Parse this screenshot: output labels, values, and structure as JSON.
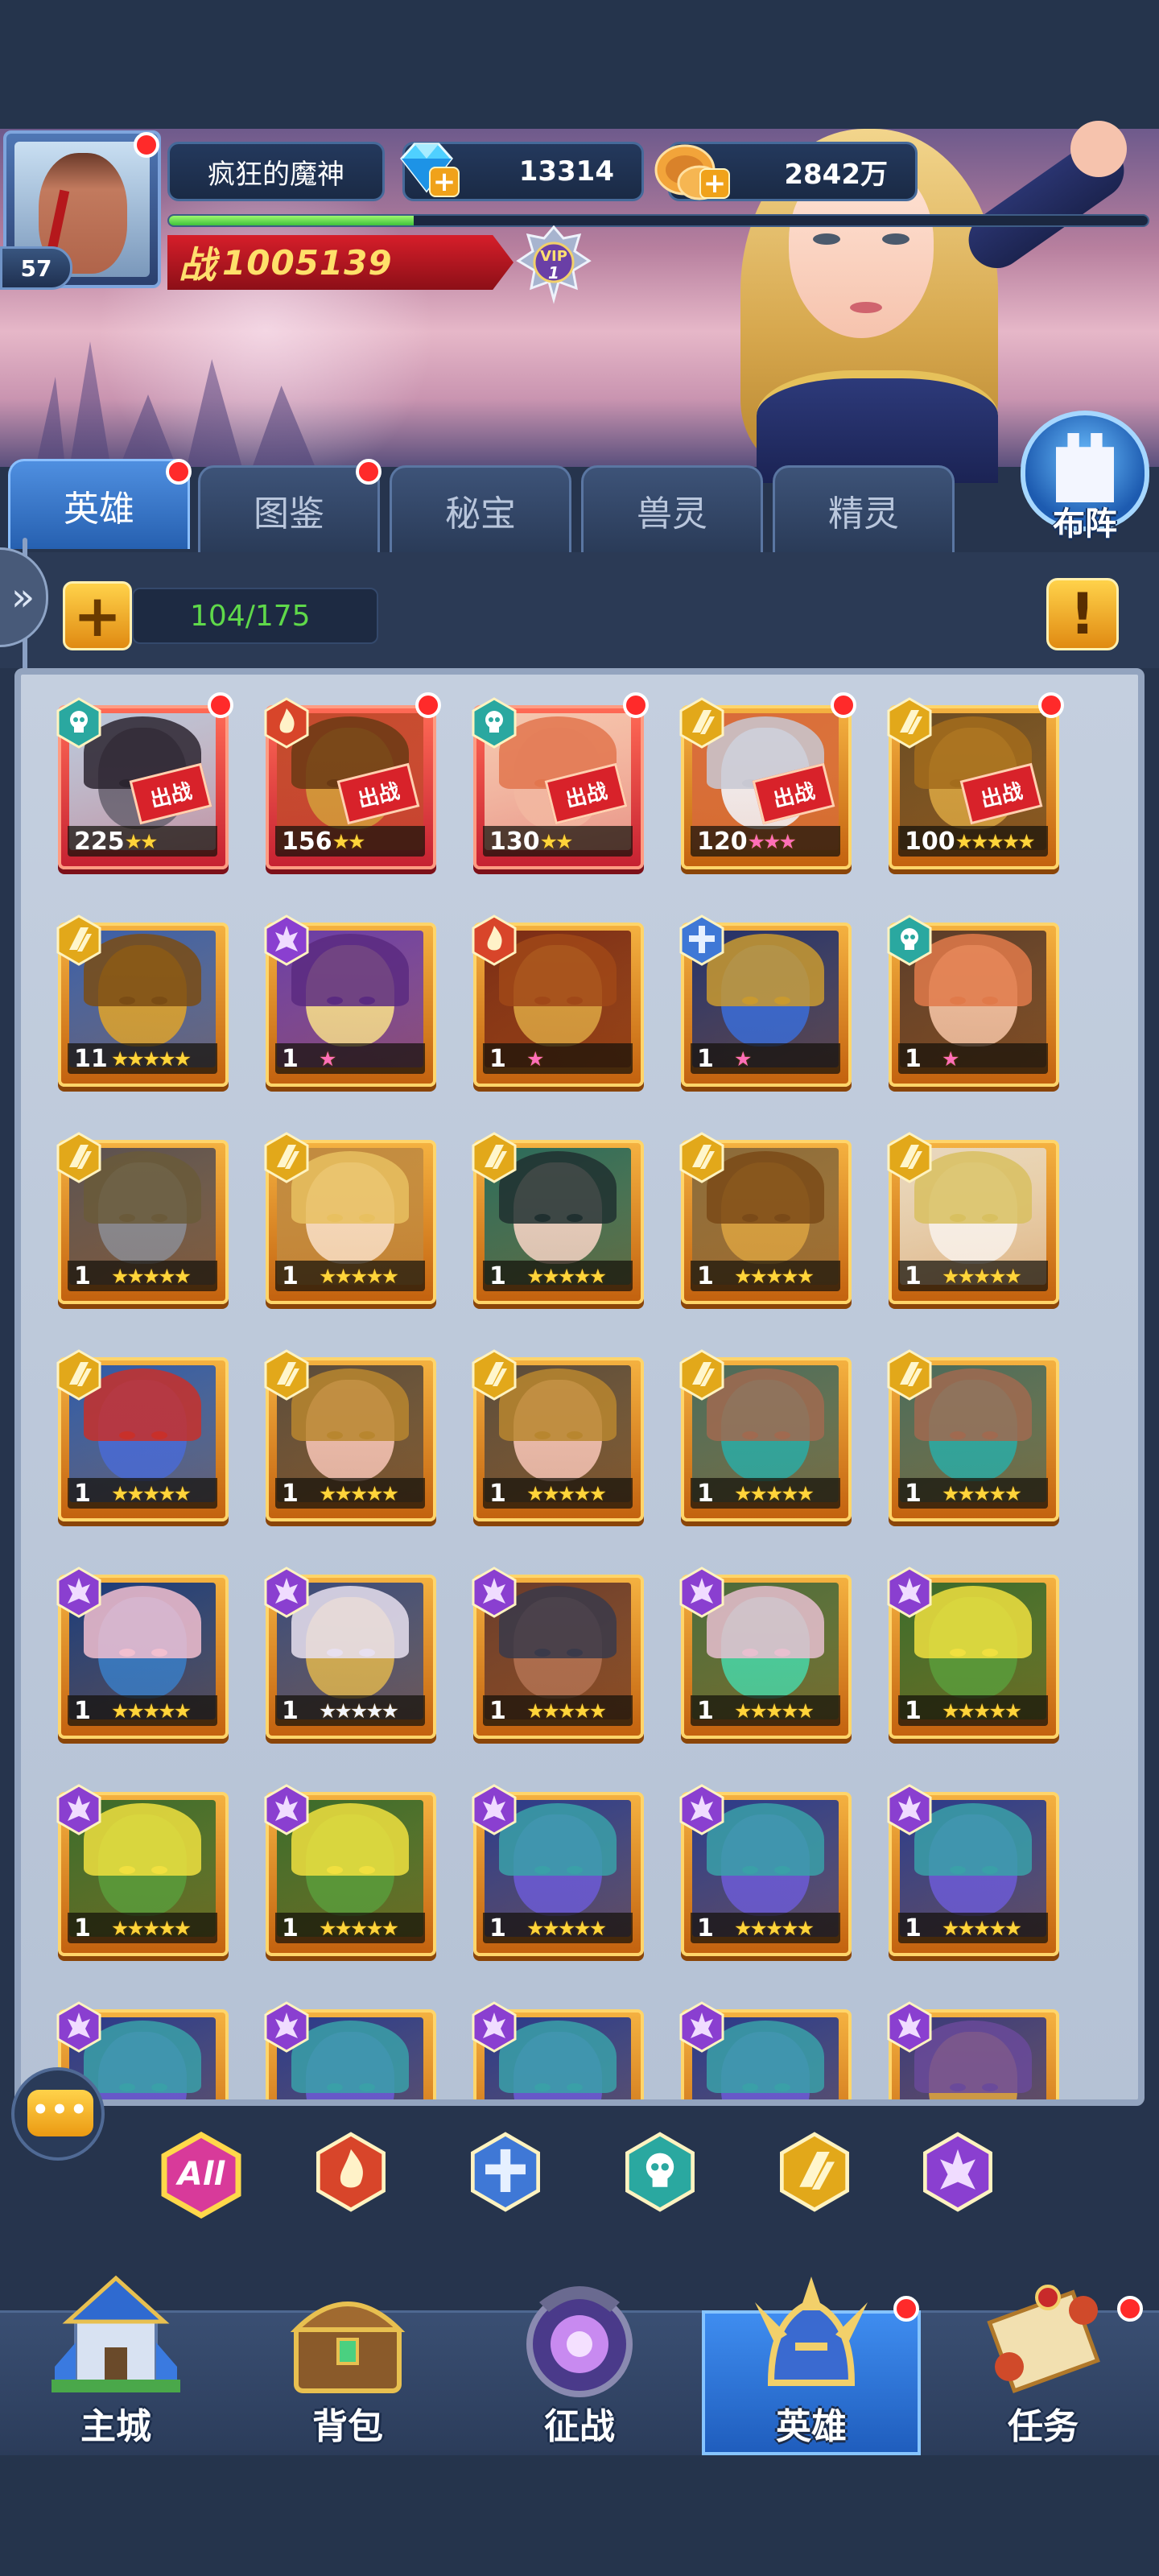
{
  "player": {
    "name": "疯狂的魔神",
    "level": "57",
    "gems": "13314",
    "gold": "2842万",
    "power_icon": "战",
    "power": "1005139",
    "vip_label": "VIP",
    "vip_level": "1",
    "xp_progress": 0.25
  },
  "tabs": [
    {
      "label": "英雄",
      "active": true,
      "dot": true
    },
    {
      "label": "图鉴",
      "active": false,
      "dot": true
    },
    {
      "label": "秘宝",
      "active": false,
      "dot": false
    },
    {
      "label": "兽灵",
      "active": false,
      "dot": false
    },
    {
      "label": "精灵",
      "active": false,
      "dot": false
    }
  ],
  "formation_label": "布阵",
  "hero_count": "104/175",
  "info_label": "!",
  "deploy_label": "出战",
  "heroes": [
    {
      "faction": "skull",
      "level": "225",
      "stars": 2,
      "star_color": "gold",
      "deployed": true,
      "dot": true,
      "red": true
    },
    {
      "faction": "fire",
      "level": "156",
      "stars": 2,
      "star_color": "gold",
      "deployed": true,
      "dot": true,
      "red": true
    },
    {
      "faction": "skull",
      "level": "130",
      "stars": 2,
      "star_color": "gold",
      "deployed": true,
      "dot": true,
      "red": true
    },
    {
      "faction": "light",
      "level": "120",
      "stars": 3,
      "star_color": "pink",
      "deployed": true,
      "dot": true,
      "red": false
    },
    {
      "faction": "light",
      "level": "100",
      "stars": 5,
      "star_color": "gold",
      "deployed": true,
      "dot": true,
      "red": false
    },
    {
      "faction": "light",
      "level": "11",
      "stars": 5,
      "star_color": "gold"
    },
    {
      "faction": "dark",
      "level": "1",
      "stars": 1,
      "star_color": "pink"
    },
    {
      "faction": "fire",
      "level": "1",
      "stars": 1,
      "star_color": "pink"
    },
    {
      "faction": "cross",
      "level": "1",
      "stars": 1,
      "star_color": "pink"
    },
    {
      "faction": "skull",
      "level": "1",
      "stars": 1,
      "star_color": "pink"
    },
    {
      "faction": "light",
      "level": "1",
      "stars": 5,
      "star_color": "gold"
    },
    {
      "faction": "light",
      "level": "1",
      "stars": 5,
      "star_color": "gold"
    },
    {
      "faction": "light",
      "level": "1",
      "stars": 5,
      "star_color": "gold"
    },
    {
      "faction": "light",
      "level": "1",
      "stars": 5,
      "star_color": "gold"
    },
    {
      "faction": "light",
      "level": "1",
      "stars": 5,
      "star_color": "gold"
    },
    {
      "faction": "light",
      "level": "1",
      "stars": 5,
      "star_color": "gold"
    },
    {
      "faction": "light",
      "level": "1",
      "stars": 5,
      "star_color": "gold"
    },
    {
      "faction": "light",
      "level": "1",
      "stars": 5,
      "star_color": "gold"
    },
    {
      "faction": "light",
      "level": "1",
      "stars": 5,
      "star_color": "gold"
    },
    {
      "faction": "light",
      "level": "1",
      "stars": 5,
      "star_color": "gold"
    },
    {
      "faction": "dark",
      "level": "1",
      "stars": 5,
      "star_color": "gold"
    },
    {
      "faction": "dark",
      "level": "1",
      "stars": 5,
      "star_color": "white"
    },
    {
      "faction": "dark",
      "level": "1",
      "stars": 5,
      "star_color": "gold"
    },
    {
      "faction": "dark",
      "level": "1",
      "stars": 5,
      "star_color": "gold"
    },
    {
      "faction": "dark",
      "level": "1",
      "stars": 5,
      "star_color": "gold"
    },
    {
      "faction": "dark",
      "level": "1",
      "stars": 5,
      "star_color": "gold"
    },
    {
      "faction": "dark",
      "level": "1",
      "stars": 5,
      "star_color": "gold"
    },
    {
      "faction": "dark",
      "level": "1",
      "stars": 5,
      "star_color": "gold"
    },
    {
      "faction": "dark",
      "level": "1",
      "stars": 5,
      "star_color": "gold"
    },
    {
      "faction": "dark",
      "level": "1",
      "stars": 5,
      "star_color": "gold"
    },
    {
      "faction": "dark",
      "level": "",
      "stars": 0,
      "star_color": "gold"
    },
    {
      "faction": "dark",
      "level": "",
      "stars": 0,
      "star_color": "gold"
    },
    {
      "faction": "dark",
      "level": "",
      "stars": 0,
      "star_color": "gold"
    },
    {
      "faction": "dark",
      "level": "",
      "stars": 0,
      "star_color": "gold"
    },
    {
      "faction": "dark",
      "level": "",
      "stars": 0,
      "star_color": "gold"
    }
  ],
  "filters": [
    {
      "name": "all",
      "label": "All",
      "color": "#d83a9a"
    },
    {
      "name": "fire",
      "label": "",
      "color": "#d8452a"
    },
    {
      "name": "cross",
      "label": "",
      "color": "#3f78d6"
    },
    {
      "name": "skull",
      "label": "",
      "color": "#2aa8a0"
    },
    {
      "name": "light",
      "label": "",
      "color": "#e2a81a"
    },
    {
      "name": "dark",
      "label": "",
      "color": "#8a3fd0"
    }
  ],
  "nav": [
    {
      "label": "主城",
      "icon": "castle-icon",
      "active": false,
      "dot": false
    },
    {
      "label": "背包",
      "icon": "chest-icon",
      "active": false,
      "dot": false
    },
    {
      "label": "征战",
      "icon": "dragon-portal-icon",
      "active": false,
      "dot": false
    },
    {
      "label": "英雄",
      "icon": "hero-helmet-icon",
      "active": true,
      "dot": true
    },
    {
      "label": "任务",
      "icon": "scroll-icon",
      "active": false,
      "dot": true
    }
  ],
  "chat_dots": "•••"
}
